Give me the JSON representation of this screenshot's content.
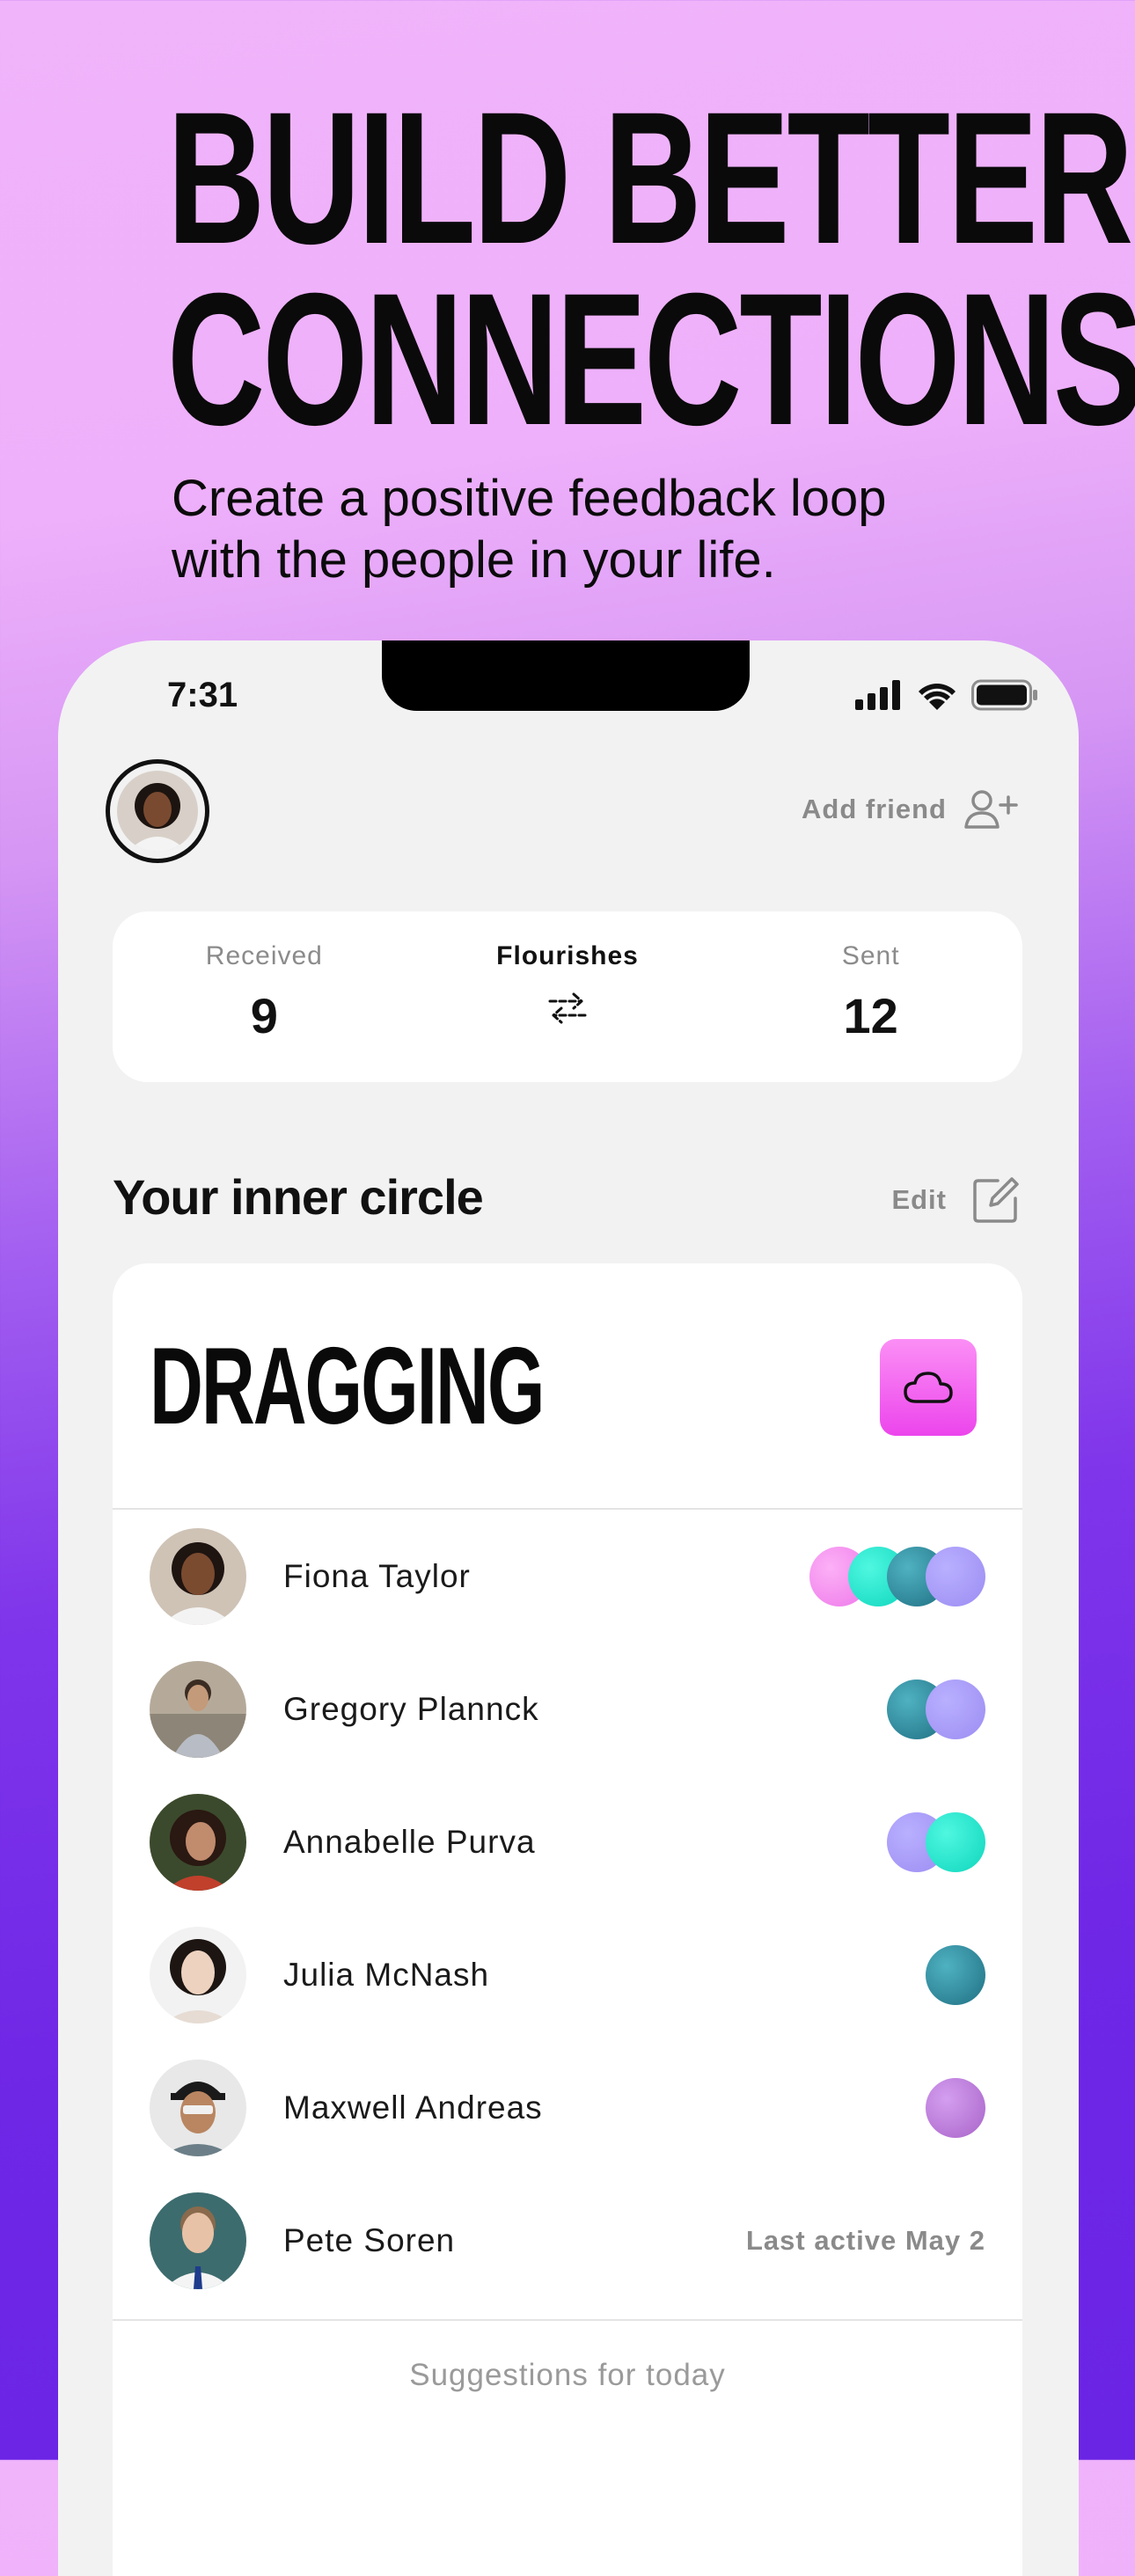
{
  "headline": {
    "line1": "BUILD BETTER",
    "line2": "CONNECTIONS"
  },
  "subline": {
    "line1": "Create a positive feedback loop",
    "line2": "with the people in your life."
  },
  "status_bar": {
    "time": "7:31"
  },
  "header": {
    "add_friend_label": "Add friend"
  },
  "stats": {
    "received": {
      "label": "Received",
      "value": "9"
    },
    "middle_label": "Flourishes",
    "sent": {
      "label": "Sent",
      "value": "12"
    }
  },
  "inner_circle": {
    "title": "Your inner circle",
    "edit_label": "Edit",
    "mood_title": "DRAGGING",
    "people": [
      {
        "name": "Fiona Taylor",
        "dots": [
          "#f58cf0",
          "#13e8cf",
          "#2b8ea0",
          "#a89af6"
        ]
      },
      {
        "name": "Gregory Plannck",
        "dots": [
          "#2b8ea0",
          "#a89af6"
        ]
      },
      {
        "name": "Annabelle Purva",
        "dots": [
          "#a89af6",
          "#13e8cf"
        ]
      },
      {
        "name": "Julia McNash",
        "dots": [
          "#2b8ea0"
        ]
      },
      {
        "name": "Maxwell Andreas",
        "dots": [
          "#b57ad8"
        ]
      },
      {
        "name": "Pete Soren",
        "last_active": "Last active May 2"
      }
    ],
    "suggestions_label": "Suggestions for today"
  },
  "colors": {
    "accent_pink": "#ec45ec",
    "muted_text": "#8a8a8a"
  }
}
